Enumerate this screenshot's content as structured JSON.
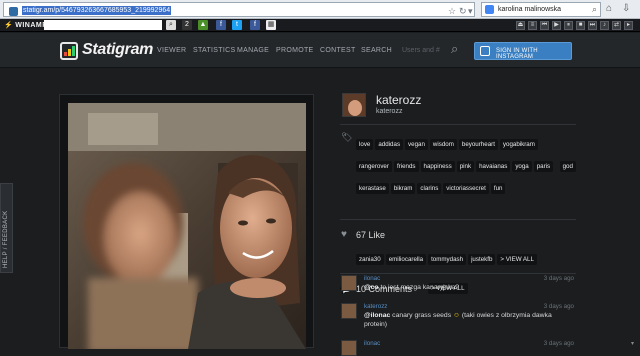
{
  "browser": {
    "url": "statigr.am/p/546793263667685953_219992964",
    "search_value": "karolina malinowska",
    "toolbar_name": "WINAMP"
  },
  "nav": {
    "logo_text": "Statigram",
    "links": [
      "VIEWER",
      "STATISTICS",
      "MANAGE",
      "PROMOTE",
      "CONTEST",
      "SEARCH"
    ],
    "search_placeholder": "Users and #",
    "signin_label": "SIGN IN WITH INSTAGRAM"
  },
  "side_tab": "HELP / FEEDBACK",
  "profile": {
    "username": "katerozz",
    "subname": "katerozz"
  },
  "tags": [
    "love",
    "addidas",
    "vegan",
    "wisdom",
    "beyourheart",
    "yogabikram",
    "rangerover",
    "friends",
    "happiness",
    "pink",
    "havaianas",
    "yoga",
    "paris",
    "god",
    "kerastase",
    "bikram",
    "clarins",
    "victoriassecret",
    "fun"
  ],
  "likes": {
    "title": "67 Like",
    "users": [
      "zania30",
      "emiliocarella",
      "tommydash",
      "justekfb",
      "> VIEW ALL"
    ]
  },
  "comments": {
    "title": "10 Comments",
    "view_all": "> VIEW ALL",
    "items": [
      {
        "author": "ilonac",
        "time": "3 days ago",
        "mention": "@co",
        "text": " to jest mazga kanaryjska?"
      },
      {
        "author": "katerozz",
        "time": "3 days ago",
        "mention": "@ilonac",
        "text": " canary grass seeds ",
        "after_emoji": " (taki owies z olbrzymia dawka protein)"
      },
      {
        "author": "ilonac",
        "time": "3 days ago",
        "mention": "",
        "text": ""
      }
    ]
  },
  "colors": {
    "accent": "#3a7fc1",
    "background": "#1b1d1f",
    "link": "#5a8fc4"
  }
}
